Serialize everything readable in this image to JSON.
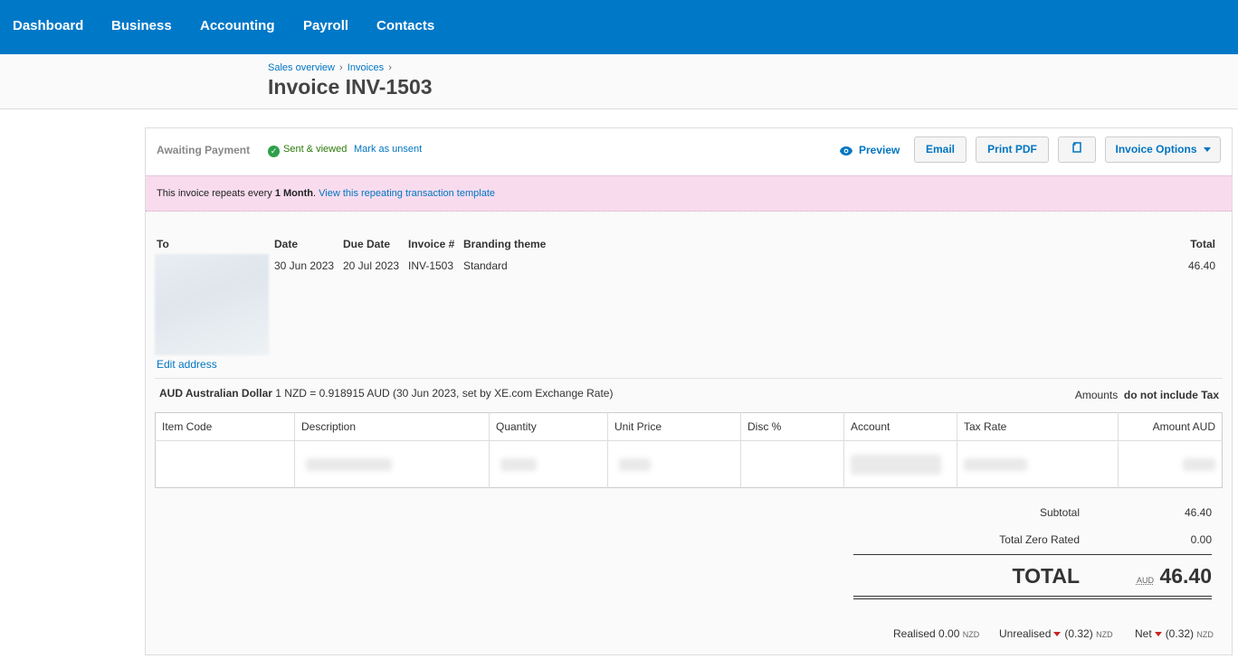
{
  "nav": {
    "items": [
      "Dashboard",
      "Business",
      "Accounting",
      "Payroll",
      "Contacts"
    ]
  },
  "breadcrumb": {
    "items": [
      "Sales overview",
      "Invoices"
    ],
    "separator": "›"
  },
  "page_title": "Invoice INV-1503",
  "toolbar": {
    "status": "Awaiting Payment",
    "sent_status": "Sent & viewed",
    "mark_unsent": "Mark as unsent",
    "preview": "Preview",
    "email": "Email",
    "print_pdf": "Print PDF",
    "invoice_options": "Invoice Options"
  },
  "repeat_notice": {
    "prefix": "This invoice repeats every ",
    "period": "1 Month",
    "suffix": ". ",
    "link": "View this repeating transaction template"
  },
  "invoice": {
    "headers": {
      "to": "To",
      "date": "Date",
      "due_date": "Due Date",
      "invoice_no": "Invoice #",
      "branding": "Branding theme",
      "total": "Total"
    },
    "values": {
      "date": "30 Jun 2023",
      "due_date": "20 Jul 2023",
      "invoice_no": "INV-1503",
      "branding": "Standard",
      "total": "46.40"
    },
    "edit_address": "Edit address"
  },
  "currency": {
    "name": "AUD Australian Dollar",
    "rate": "1 NZD = 0.918915 AUD (30 Jun 2023, set by XE.com Exchange Rate)"
  },
  "amounts_tax": {
    "label": "Amounts",
    "value": "do not include Tax"
  },
  "table": {
    "columns": [
      "Item Code",
      "Description",
      "Quantity",
      "Unit Price",
      "Disc %",
      "Account",
      "Tax Rate",
      "Amount AUD"
    ]
  },
  "totals": {
    "subtotal_label": "Subtotal",
    "subtotal": "46.40",
    "zero_rated_label": "Total Zero Rated",
    "zero_rated": "0.00",
    "total_label": "TOTAL",
    "total_currency": "AUD",
    "total": "46.40"
  },
  "fx": {
    "realised_label": "Realised",
    "realised": "0.00",
    "unrealised_label": "Unrealised",
    "unrealised": "(0.32)",
    "net_label": "Net",
    "net": "(0.32)",
    "currency": "NZD"
  },
  "colors": {
    "nav_bg": "#0078c8",
    "link": "#0075c2",
    "repeat_bg": "#f8dcee",
    "sent_green": "#2ea04a",
    "loss_red": "#cc2222"
  }
}
